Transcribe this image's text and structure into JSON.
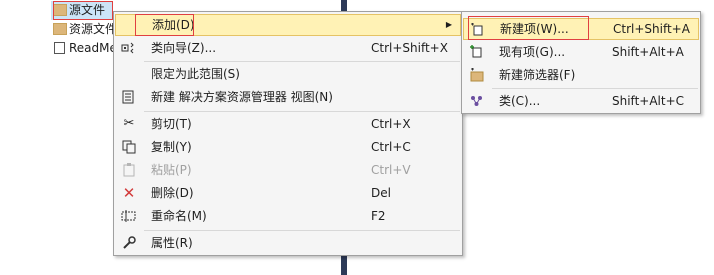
{
  "tree": {
    "items": [
      {
        "label": "源文件",
        "icon": "folder-icon"
      },
      {
        "label": "资源文件",
        "icon": "folder-icon"
      },
      {
        "label": "ReadMe",
        "icon": "file-icon"
      }
    ]
  },
  "context_menu": {
    "items": [
      {
        "label": "添加(D)",
        "shortcut": "",
        "icon": ""
      },
      {
        "label": "类向导(Z)...",
        "shortcut": "Ctrl+Shift+X",
        "icon": "class-wizard-icon"
      },
      {
        "label": "限定为此范围(S)",
        "shortcut": "",
        "icon": ""
      },
      {
        "label": "新建 解决方案资源管理器 视图(N)",
        "shortcut": "",
        "icon": "new-view-icon"
      },
      {
        "label": "剪切(T)",
        "shortcut": "Ctrl+X",
        "icon": "scissors-icon"
      },
      {
        "label": "复制(Y)",
        "shortcut": "Ctrl+C",
        "icon": "copy-icon"
      },
      {
        "label": "粘贴(P)",
        "shortcut": "Ctrl+V",
        "icon": "paste-icon"
      },
      {
        "label": "删除(D)",
        "shortcut": "Del",
        "icon": "delete-icon"
      },
      {
        "label": "重命名(M)",
        "shortcut": "F2",
        "icon": "rename-icon"
      },
      {
        "label": "属性(R)",
        "shortcut": "",
        "icon": "properties-icon"
      }
    ]
  },
  "submenu": {
    "items": [
      {
        "label": "新建项(W)...",
        "shortcut": "Ctrl+Shift+A",
        "icon": "new-item-icon"
      },
      {
        "label": "现有项(G)...",
        "shortcut": "Shift+Alt+A",
        "icon": "existing-item-icon"
      },
      {
        "label": "新建筛选器(F)",
        "shortcut": "",
        "icon": "new-filter-icon"
      },
      {
        "label": "类(C)...",
        "shortcut": "Shift+Alt+C",
        "icon": "class-icon"
      }
    ]
  },
  "colors": {
    "highlight": "#fff2b5",
    "highlight_border": "#e5c365",
    "selection_box": "#e04040",
    "tree_selected": "#3399ff",
    "delete_red": "#d23b3b"
  }
}
